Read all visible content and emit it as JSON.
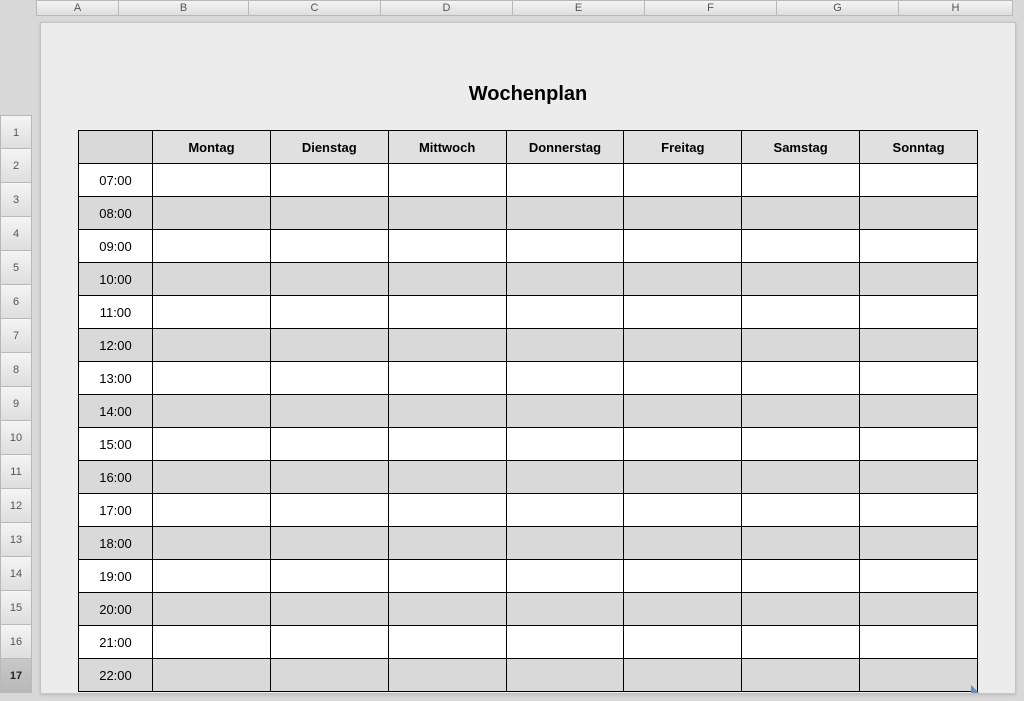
{
  "column_headers": [
    "A",
    "B",
    "C",
    "D",
    "E",
    "F",
    "G",
    "H"
  ],
  "row_headers": [
    "1",
    "2",
    "3",
    "4",
    "5",
    "6",
    "7",
    "8",
    "9",
    "10",
    "11",
    "12",
    "13",
    "14",
    "15",
    "16",
    "17"
  ],
  "active_row_header": "17",
  "title": "Wochenplan",
  "days": [
    "Montag",
    "Dienstag",
    "Mittwoch",
    "Donnerstag",
    "Freitag",
    "Samstag",
    "Sonntag"
  ],
  "times": [
    "07:00",
    "08:00",
    "09:00",
    "10:00",
    "11:00",
    "12:00",
    "13:00",
    "14:00",
    "15:00",
    "16:00",
    "17:00",
    "18:00",
    "19:00",
    "20:00",
    "21:00",
    "22:00"
  ],
  "cells": [
    [
      "",
      "",
      "",
      "",
      "",
      "",
      ""
    ],
    [
      "",
      "",
      "",
      "",
      "",
      "",
      ""
    ],
    [
      "",
      "",
      "",
      "",
      "",
      "",
      ""
    ],
    [
      "",
      "",
      "",
      "",
      "",
      "",
      ""
    ],
    [
      "",
      "",
      "",
      "",
      "",
      "",
      ""
    ],
    [
      "",
      "",
      "",
      "",
      "",
      "",
      ""
    ],
    [
      "",
      "",
      "",
      "",
      "",
      "",
      ""
    ],
    [
      "",
      "",
      "",
      "",
      "",
      "",
      ""
    ],
    [
      "",
      "",
      "",
      "",
      "",
      "",
      ""
    ],
    [
      "",
      "",
      "",
      "",
      "",
      "",
      ""
    ],
    [
      "",
      "",
      "",
      "",
      "",
      "",
      ""
    ],
    [
      "",
      "",
      "",
      "",
      "",
      "",
      ""
    ],
    [
      "",
      "",
      "",
      "",
      "",
      "",
      ""
    ],
    [
      "",
      "",
      "",
      "",
      "",
      "",
      ""
    ],
    [
      "",
      "",
      "",
      "",
      "",
      "",
      ""
    ],
    [
      "",
      "",
      "",
      "",
      "",
      "",
      ""
    ]
  ]
}
